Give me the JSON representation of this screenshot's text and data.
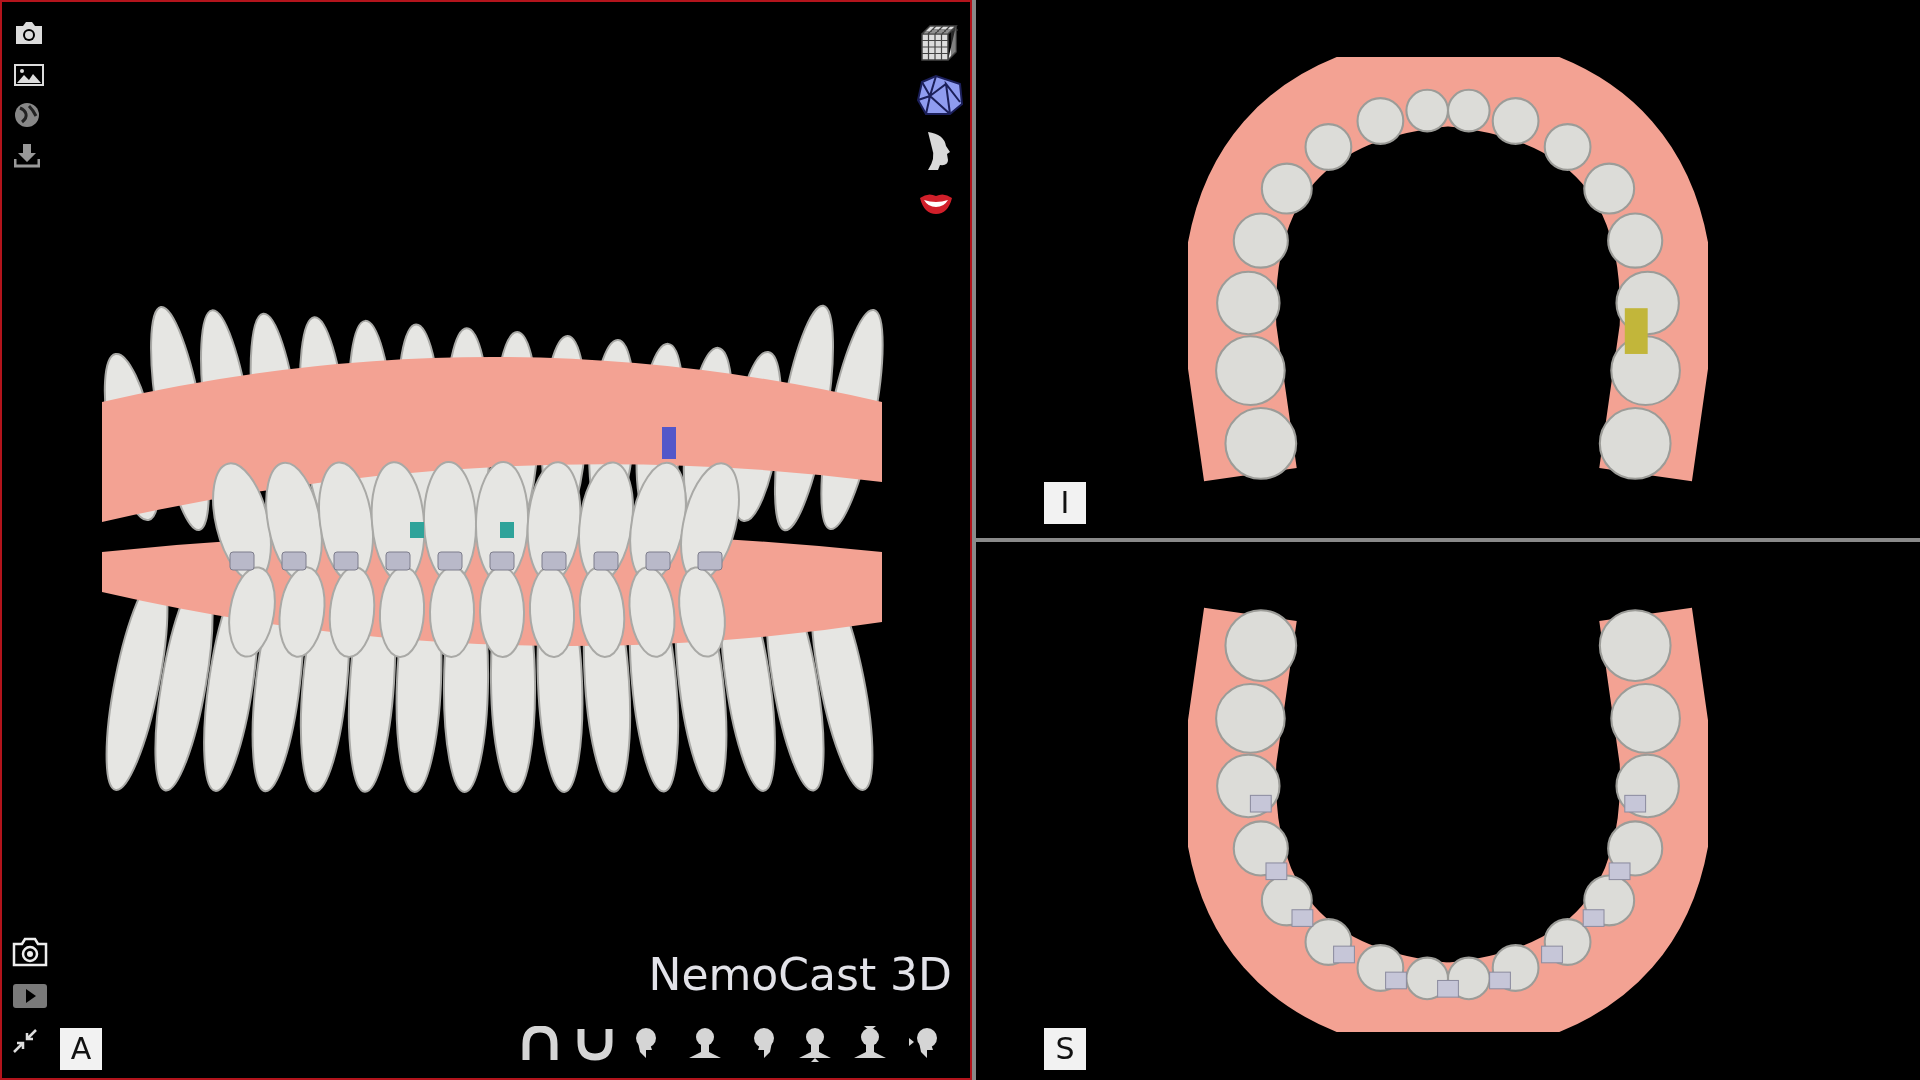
{
  "viewports": [
    {
      "kind": "front",
      "label": "A",
      "selected": true,
      "brand": "NemoCast 3D"
    },
    {
      "kind": "upper",
      "label": "I",
      "selected": false
    },
    {
      "kind": "lower",
      "label": "S",
      "selected": false
    }
  ]
}
